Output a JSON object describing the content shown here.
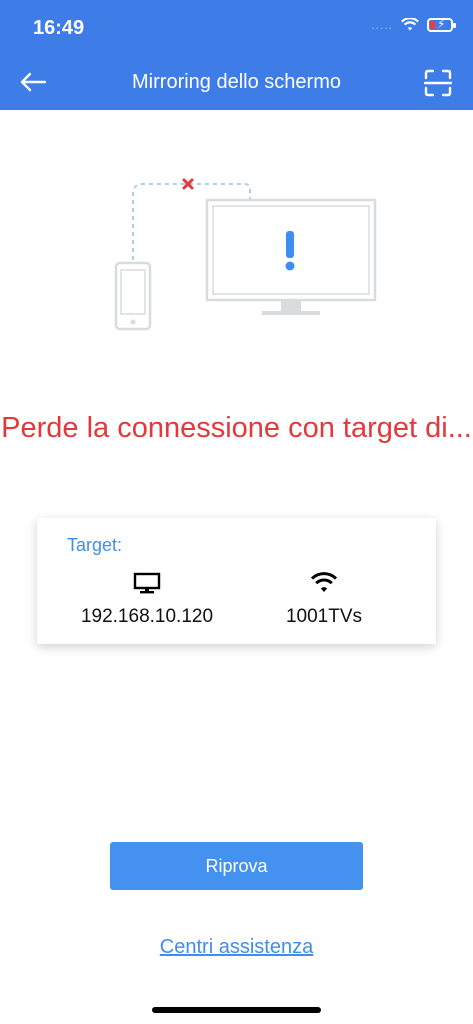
{
  "status_bar": {
    "time": "16:49",
    "signal": "....."
  },
  "nav": {
    "title": "Mirroring dello schermo",
    "back_icon": "back-arrow-icon",
    "scan_icon": "scan-icon"
  },
  "error": {
    "message": "Perde la connessione con target di..."
  },
  "target_card": {
    "label": "Target:",
    "ip_address": "192.168.10.120",
    "network_name": "1001TVs"
  },
  "actions": {
    "retry_label": "Riprova",
    "help_link": "Centri assistenza"
  },
  "colors": {
    "accent": "#3e7ce8",
    "button": "#4591f0",
    "error": "#e5383b",
    "link": "#3e8ef0"
  }
}
